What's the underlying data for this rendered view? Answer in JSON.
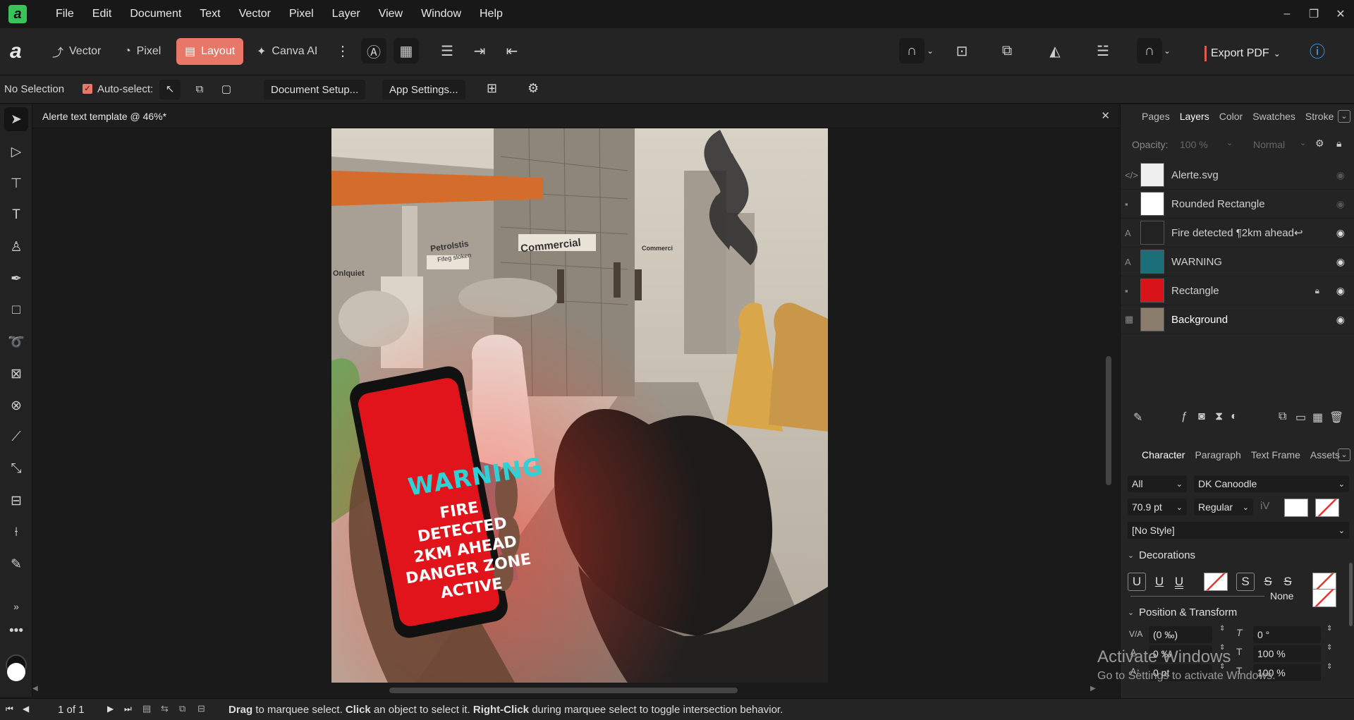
{
  "app": {
    "logo": "a",
    "menu": [
      "File",
      "Edit",
      "Document",
      "Text",
      "Vector",
      "Pixel",
      "Layer",
      "View",
      "Window",
      "Help"
    ]
  },
  "toolbar": {
    "personas": [
      {
        "label": "Vector",
        "icon": "vector-persona-icon"
      },
      {
        "label": "Pixel",
        "icon": "pixel-persona-icon"
      },
      {
        "label": "Layout",
        "icon": "layout-persona-icon",
        "active": true
      },
      {
        "label": "Canva AI",
        "icon": "canva-ai-icon"
      }
    ],
    "export_label": "Export PDF"
  },
  "context": {
    "selection": "No Selection",
    "auto_select": "Auto-select:",
    "doc_setup": "Document Setup...",
    "app_settings": "App Settings..."
  },
  "document": {
    "title": "Alerte text template @ 46%*",
    "phone_text": {
      "heading": "WARNING",
      "lines": [
        "FIRE DETECTED",
        "2KM AHEAD",
        "DANGER ZONE",
        "ACTIVE"
      ]
    },
    "signs": [
      "Petrolstis",
      "Fifeg sloken",
      "Commercial",
      "Onlquiet",
      "Commerci"
    ]
  },
  "panel_top": {
    "tabs": [
      "Pages",
      "Layers",
      "Color",
      "Swatches",
      "Stroke"
    ],
    "selected_tab": "Layers",
    "opacity_label": "Opacity:",
    "opacity_value": "100 %",
    "blend_mode": "Normal",
    "layers": [
      {
        "name": "Alerte.svg",
        "type": "</>",
        "visible": false
      },
      {
        "name": "Rounded Rectangle",
        "type": "▪",
        "visible": false
      },
      {
        "name": "Fire detected ¶2km ahead↩",
        "type": "A",
        "visible": true
      },
      {
        "name": "WARNING",
        "type": "A",
        "visible": true
      },
      {
        "name": "Rectangle",
        "type": "▪",
        "visible": true,
        "locked": true
      },
      {
        "name": "Background",
        "type": "▦",
        "visible": true
      }
    ]
  },
  "panel_bottom": {
    "tabs": [
      "Character",
      "Paragraph",
      "Text Frame",
      "Assets"
    ],
    "selected_tab": "Character",
    "scope": "All",
    "font": "DK Canoodle",
    "size": "70.9 pt",
    "weight": "Regular",
    "style": "[No Style]",
    "decorations_title": "Decorations",
    "decoration_none": "None",
    "position_title": "Position & Transform",
    "tracking": "(0 ‰)",
    "shear": "0 °",
    "kerning": "0 ‰",
    "vscale": "100 %",
    "baseline": "0 pt",
    "hscale": "100 %"
  },
  "status": {
    "page": "1 of 1",
    "hint_parts": [
      {
        "text": "Drag",
        "bold": true
      },
      {
        "text": " to marquee select. ",
        "bold": false
      },
      {
        "text": "Click",
        "bold": true
      },
      {
        "text": " an object to select it. ",
        "bold": false
      },
      {
        "text": "Right-Click",
        "bold": true
      },
      {
        "text": " during marquee select to toggle intersection behavior.",
        "bold": false
      }
    ]
  },
  "watermark": {
    "title": "Activate Windows",
    "subtitle": "Go to Settings to activate Windows."
  },
  "colors": {
    "accent": "#e8776a",
    "export_bar": "#e35b4f",
    "warning_text": "#2ed1d6",
    "phone_screen": "#e0141a"
  }
}
